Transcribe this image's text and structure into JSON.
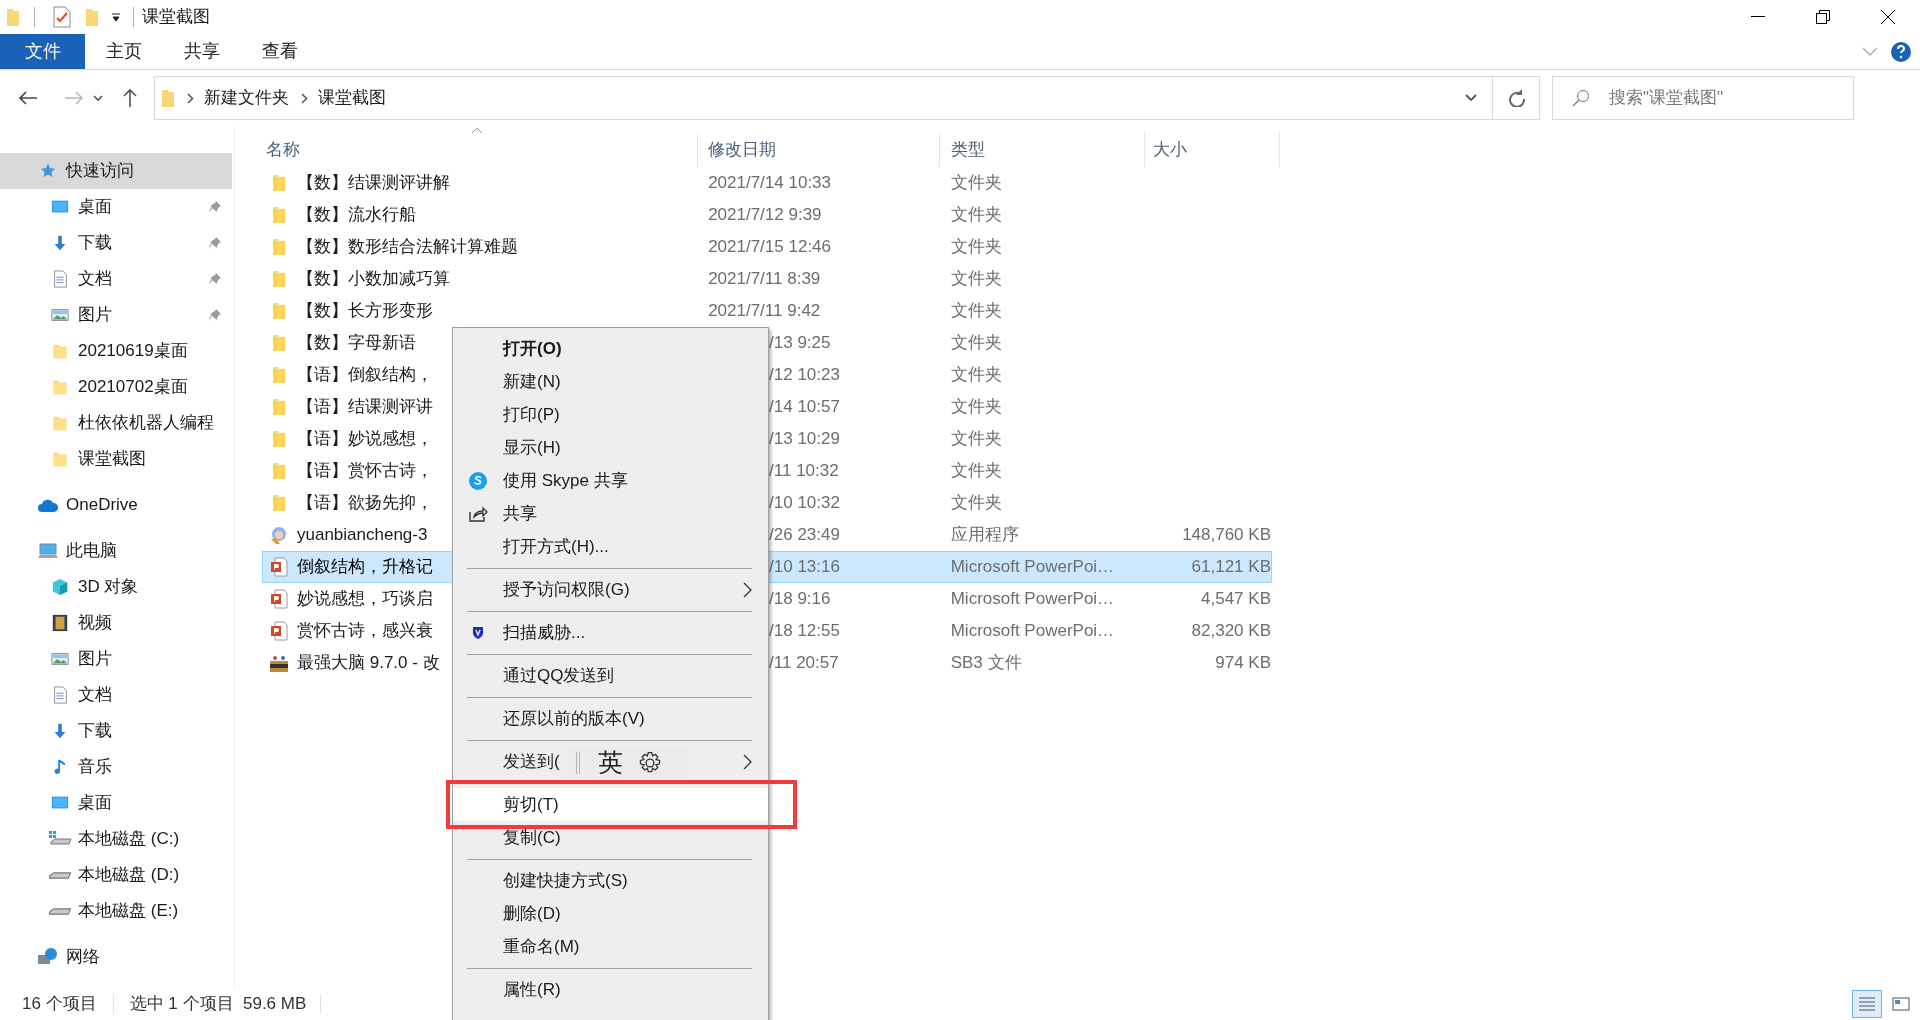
{
  "window": {
    "title": "课堂截图"
  },
  "ribbon_tabs": [
    {
      "label": "文件",
      "selected": true
    },
    {
      "label": "主页",
      "selected": false
    },
    {
      "label": "共享",
      "selected": false
    },
    {
      "label": "查看",
      "selected": false
    }
  ],
  "address_bar": {
    "breadcrumbs": [
      "新建文件夹",
      "课堂截图"
    ]
  },
  "search": {
    "placeholder": "搜索\"课堂截图\""
  },
  "sidebar": {
    "items": [
      {
        "label": "快速访问",
        "kind": "star",
        "selected": true,
        "children": [
          {
            "label": "桌面",
            "kind": "desktop",
            "pinned": true,
            "selected": false
          },
          {
            "label": "下载",
            "kind": "download",
            "pinned": true,
            "selected": false
          },
          {
            "label": "文档",
            "kind": "document",
            "pinned": true,
            "selected": false
          },
          {
            "label": "图片",
            "kind": "pictures",
            "pinned": true,
            "selected": false
          },
          {
            "label": "20210619桌面",
            "kind": "folder",
            "pinned": false,
            "selected": false
          },
          {
            "label": "20210702桌面",
            "kind": "folder",
            "pinned": false,
            "selected": false
          },
          {
            "label": "杜依依机器人编程",
            "kind": "folder",
            "pinned": false,
            "selected": false
          },
          {
            "label": "课堂截图",
            "kind": "folder",
            "pinned": false,
            "selected": false
          }
        ]
      },
      {
        "label": "OneDrive",
        "kind": "cloud",
        "selected": false
      },
      {
        "label": "此电脑",
        "kind": "pc",
        "selected": false,
        "children": [
          {
            "label": "3D 对象",
            "kind": "cube",
            "pinned": false,
            "selected": false
          },
          {
            "label": "视频",
            "kind": "video",
            "pinned": false,
            "selected": false
          },
          {
            "label": "图片",
            "kind": "pictures",
            "pinned": false,
            "selected": false
          },
          {
            "label": "文档",
            "kind": "document",
            "pinned": false,
            "selected": false
          },
          {
            "label": "下载",
            "kind": "download",
            "pinned": false,
            "selected": false
          },
          {
            "label": "音乐",
            "kind": "music",
            "pinned": false,
            "selected": false
          },
          {
            "label": "桌面",
            "kind": "desktop",
            "pinned": false,
            "selected": false
          },
          {
            "label": "本地磁盘 (C:)",
            "kind": "system-drive",
            "pinned": false,
            "selected": false
          },
          {
            "label": "本地磁盘 (D:)",
            "kind": "drive",
            "pinned": false,
            "selected": false
          },
          {
            "label": "本地磁盘 (E:)",
            "kind": "drive",
            "pinned": false,
            "selected": false
          }
        ]
      },
      {
        "label": "网络",
        "kind": "network",
        "selected": false
      }
    ]
  },
  "table": {
    "columns": [
      "名称",
      "修改日期",
      "类型",
      "大小"
    ],
    "rows": [
      {
        "kind": "folder",
        "name": "【数】结课测评讲解",
        "date": "2021/7/14 10:33",
        "type": "文件夹",
        "selected": false
      },
      {
        "kind": "folder",
        "name": "【数】流水行船",
        "date": "2021/7/12 9:39",
        "type": "文件夹",
        "selected": false
      },
      {
        "kind": "folder",
        "name": "【数】数形结合法解计算难题",
        "date": "2021/7/15 12:46",
        "type": "文件夹",
        "selected": false
      },
      {
        "kind": "folder",
        "name": "【数】小数加减巧算",
        "date": "2021/7/11 8:39",
        "type": "文件夹",
        "selected": false
      },
      {
        "kind": "folder",
        "name": "【数】长方形变形",
        "date": "2021/7/11 9:42",
        "type": "文件夹",
        "selected": false
      },
      {
        "kind": "folder",
        "name": "【数】字母新语",
        "date": "/13 9:25",
        "type": "文件夹",
        "selected": false
      },
      {
        "kind": "folder",
        "name": "【语】倒叙结构，",
        "date": "/12 10:23",
        "type": "文件夹",
        "selected": false
      },
      {
        "kind": "folder",
        "name": "【语】结课测评讲",
        "date": "/14 10:57",
        "type": "文件夹",
        "selected": false
      },
      {
        "kind": "folder",
        "name": "【语】妙说感想，",
        "date": "/13 10:29",
        "type": "文件夹",
        "selected": false
      },
      {
        "kind": "folder",
        "name": "【语】赏怀古诗，",
        "date": "/11 10:32",
        "type": "文件夹",
        "selected": false
      },
      {
        "kind": "folder",
        "name": "【语】欲扬先抑，",
        "date": "/10 10:32",
        "type": "文件夹",
        "selected": false
      },
      {
        "kind": "app",
        "name": "yuanbiancheng-3",
        "date": "/26 23:49",
        "type": "应用程序",
        "size": "148,760 KB",
        "selected": false
      },
      {
        "kind": "pptx",
        "name": "倒叙结构，升格记",
        "date": "/10 13:16",
        "type": "Microsoft PowerPoi…",
        "size": "61,121 KB",
        "selected": true
      },
      {
        "kind": "pptx",
        "name": "妙说感想，巧谈启",
        "date": "/18 9:16",
        "type": "Microsoft PowerPoi…",
        "size": "4,547 KB",
        "selected": false
      },
      {
        "kind": "pptx",
        "name": "赏怀古诗，感兴衰",
        "date": "/18 12:55",
        "type": "Microsoft PowerPoi…",
        "size": "82,320 KB",
        "selected": false
      },
      {
        "kind": "sb3",
        "name": "最强大脑 9.7.0 - 改",
        "date": "/11 20:57",
        "type": "SB3 文件",
        "size": "974 KB",
        "selected": false
      }
    ]
  },
  "context_menu": {
    "items": [
      {
        "kind": "item",
        "label": "打开(O)",
        "default": true,
        "highlighted": false
      },
      {
        "kind": "item",
        "label": "新建(N)",
        "default": false,
        "highlighted": false
      },
      {
        "kind": "item",
        "label": "打印(P)",
        "default": false,
        "highlighted": false
      },
      {
        "kind": "item",
        "label": "显示(H)",
        "default": false,
        "highlighted": false
      },
      {
        "kind": "skype",
        "label": "使用 Skype 共享",
        "default": false,
        "highlighted": false
      },
      {
        "kind": "share",
        "label": "共享",
        "default": false,
        "highlighted": false
      },
      {
        "kind": "item",
        "label": "打开方式(H)...",
        "default": false,
        "highlighted": false
      },
      {
        "kind": "separator"
      },
      {
        "kind": "submenu",
        "label": "授予访问权限(G)",
        "default": false,
        "highlighted": false
      },
      {
        "kind": "separator"
      },
      {
        "kind": "shield",
        "label": "扫描威胁...",
        "default": false,
        "highlighted": false
      },
      {
        "kind": "separator"
      },
      {
        "kind": "item",
        "label": "通过QQ发送到",
        "default": false,
        "highlighted": false
      },
      {
        "kind": "separator"
      },
      {
        "kind": "item",
        "label": "还原以前的版本(V)",
        "default": false,
        "highlighted": false
      },
      {
        "kind": "separator"
      },
      {
        "kind": "submenu",
        "label": "发送到(",
        "default": false,
        "highlighted": false
      },
      {
        "kind": "separator"
      },
      {
        "kind": "item",
        "label": "剪切(T)",
        "default": false,
        "highlighted": true
      },
      {
        "kind": "item",
        "label": "复制(C)",
        "default": false,
        "highlighted": false
      },
      {
        "kind": "separator"
      },
      {
        "kind": "item",
        "label": "创建快捷方式(S)",
        "default": false,
        "highlighted": false
      },
      {
        "kind": "item",
        "label": "删除(D)",
        "default": false,
        "highlighted": false
      },
      {
        "kind": "item",
        "label": "重命名(M)",
        "default": false,
        "highlighted": false
      },
      {
        "kind": "separator"
      },
      {
        "kind": "item",
        "label": "属性(R)",
        "default": false,
        "highlighted": false
      }
    ]
  },
  "ime_toolbar": {
    "mode": "英"
  },
  "status_bar": {
    "item_count": "16 个项目",
    "selection": "选中 1 个项目  59.6 MB"
  },
  "view_buttons": [
    {
      "kind": "details",
      "selected": true
    },
    {
      "kind": "tiles",
      "selected": false
    }
  ]
}
